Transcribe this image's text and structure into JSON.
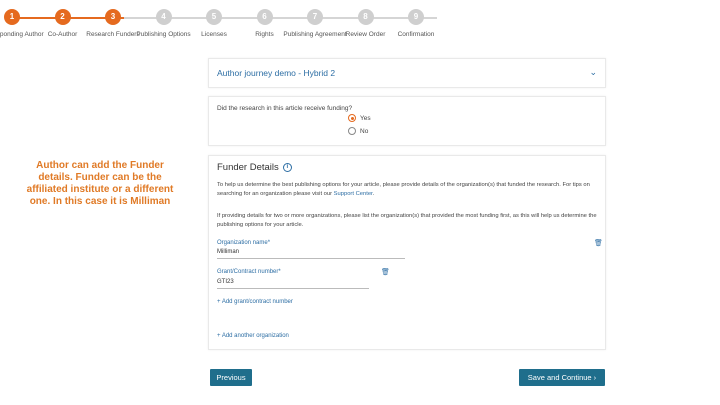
{
  "stepper": {
    "steps": [
      {
        "num": "1",
        "label": "Corresponding Author",
        "done": true
      },
      {
        "num": "2",
        "label": "Co-Author",
        "done": true
      },
      {
        "num": "3",
        "label": "Research Funders",
        "done": true
      },
      {
        "num": "4",
        "label": "Publishing Options",
        "done": false
      },
      {
        "num": "5",
        "label": "Licenses",
        "done": false
      },
      {
        "num": "6",
        "label": "Rights",
        "done": false
      },
      {
        "num": "7",
        "label": "Publishing Agreement",
        "done": false
      },
      {
        "num": "8",
        "label": "Review Order",
        "done": false
      },
      {
        "num": "9",
        "label": "Confirmation",
        "done": false
      }
    ]
  },
  "journey": {
    "title": "Author journey demo - Hybrid 2"
  },
  "funding_question": {
    "question": "Did the research in this article receive funding?",
    "yes_label": "Yes",
    "no_label": "No",
    "selected": "Yes"
  },
  "funder": {
    "title": "Funder Details",
    "para1": "To help us determine the best publishing options for your article, please provide details of the organization(s) that funded the research. For tips on searching for an organization please visit our",
    "para1_link": "Support Center",
    "para2": "If providing details for two or more organizations, please list the organization(s) that provided the most funding first, as this will help us determine the publishing options for your article.",
    "org_label": "Organization name*",
    "org_value": "Milliman",
    "grant_label": "Grant/Contract number*",
    "grant_value": "GTI23",
    "add_grant": "+ Add grant/contract number",
    "add_org": "+ Add another organization"
  },
  "annotation": {
    "text": "Author can add the Funder details. Funder can be the affiliated institute or a different one. In this case it is Milliman"
  },
  "buttons": {
    "previous": "Previous",
    "next": "Save and Continue ›"
  },
  "colors": {
    "accent_orange": "#e56a1f",
    "link_blue": "#2d6ea4",
    "button_teal": "#1f6e8c",
    "annotation_orange": "#e07a26"
  }
}
